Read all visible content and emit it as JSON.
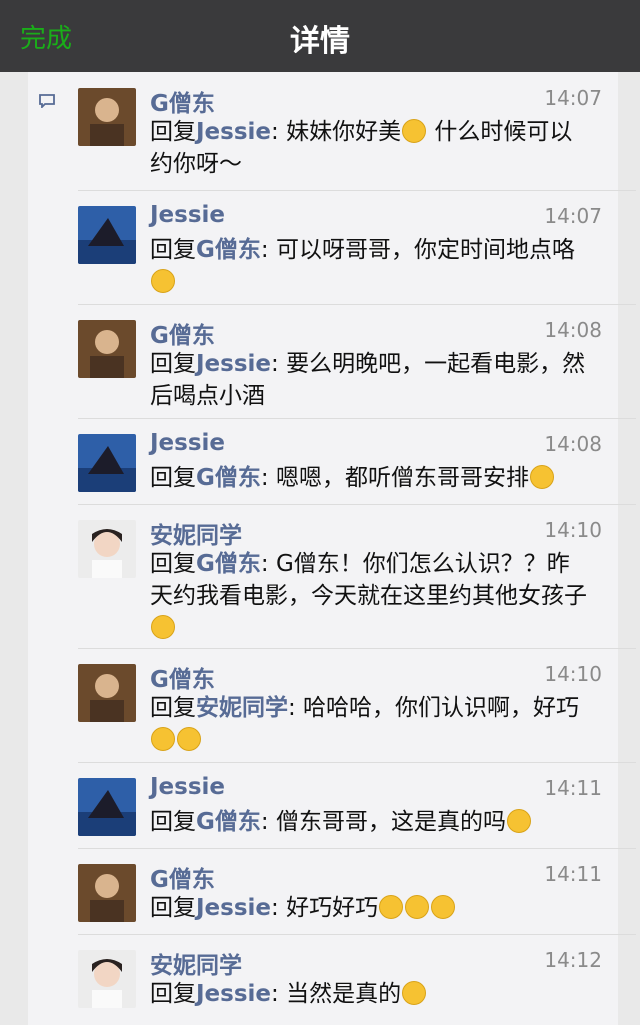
{
  "navbar": {
    "done_label": "完成",
    "title": "详情"
  },
  "comments": [
    {
      "name": "G僧东",
      "time": "14:07",
      "reply_prefix": "回复",
      "reply_to": "Jessie",
      "sep": ":",
      "text": " 妹妹你好美",
      "emoji": [
        "smile"
      ],
      "after": " 什么时候可以约你呀～"
    },
    {
      "name": "Jessie",
      "time": "14:07",
      "reply_prefix": "回复",
      "reply_to": "G僧东",
      "sep": ":",
      "text": " 可以呀哥哥，你定时间地点咯",
      "emoji": [
        "laugh"
      ],
      "after": ""
    },
    {
      "name": "G僧东",
      "time": "14:08",
      "reply_prefix": "回复",
      "reply_to": "Jessie",
      "sep": ":",
      "text": " 要么明晚吧，一起看电影，然后喝点小酒",
      "emoji": [],
      "after": ""
    },
    {
      "name": "Jessie",
      "time": "14:08",
      "reply_prefix": "回复",
      "reply_to": "G僧东",
      "sep": ":",
      "text": " 嗯嗯，都听僧东哥哥安排",
      "emoji": [
        "kiss"
      ],
      "after": ""
    },
    {
      "name": "安妮同学",
      "time": "14:10",
      "reply_prefix": "回复",
      "reply_to": "G僧东",
      "sep": ":",
      "text": " G僧东！你们怎么认识？？昨天约我看电影，今天就在这里约其他女孩子",
      "emoji": [
        "eyeroll"
      ],
      "after": ""
    },
    {
      "name": "G僧东",
      "time": "14:10",
      "reply_prefix": "回复",
      "reply_to": "安妮同学",
      "sep": ":",
      "text": " 哈哈哈，你们认识啊，好巧",
      "emoji": [
        "tears",
        "tears"
      ],
      "after": ""
    },
    {
      "name": "Jessie",
      "time": "14:11",
      "reply_prefix": "回复",
      "reply_to": "G僧东",
      "sep": ":",
      "text": " 僧东哥哥，这是真的吗",
      "emoji": [
        "smile"
      ],
      "after": ""
    },
    {
      "name": "G僧东",
      "time": "14:11",
      "reply_prefix": "回复",
      "reply_to": "Jessie",
      "sep": ":",
      "text": " 好巧好巧",
      "emoji": [
        "tears",
        "tears",
        "tears"
      ],
      "after": ""
    },
    {
      "name": "安妮同学",
      "time": "14:12",
      "reply_prefix": "回复",
      "reply_to": "Jessie",
      "sep": ":",
      "text": " 当然是真的",
      "emoji": [
        "angry"
      ],
      "after": ""
    }
  ]
}
